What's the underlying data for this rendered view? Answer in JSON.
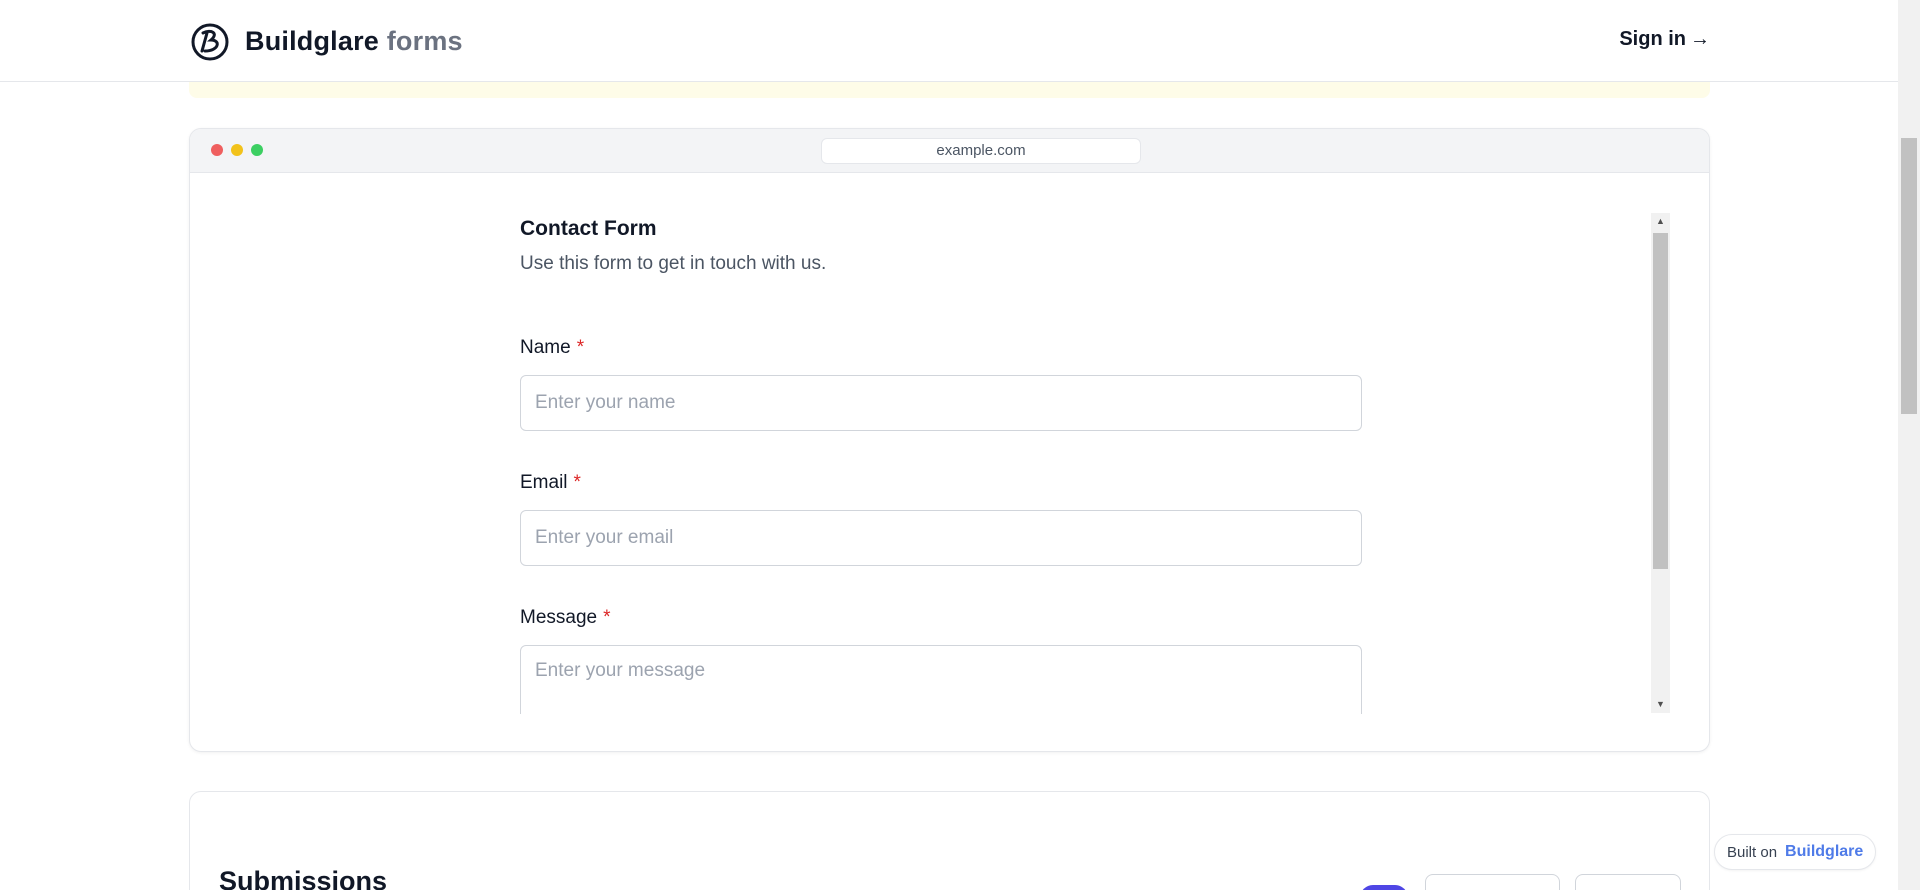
{
  "header": {
    "brand_name": "Buildglare",
    "brand_sub": "forms",
    "signin_label": "Sign in",
    "signin_arrow": "→"
  },
  "browser": {
    "url": "example.com"
  },
  "form": {
    "title": "Contact Form",
    "description": "Use this form to get in touch with us.",
    "required_mark": "*",
    "fields": [
      {
        "label": "Name",
        "placeholder": "Enter your name",
        "value": ""
      },
      {
        "label": "Email",
        "placeholder": "Enter your email",
        "value": ""
      },
      {
        "label": "Message",
        "placeholder": "Enter your message",
        "value": ""
      }
    ]
  },
  "submissions": {
    "title": "Submissions"
  },
  "badge": {
    "prefix": "Built on",
    "brand": "Buildglare"
  },
  "colors": {
    "required": "#dc2626",
    "accent": "#4f46e5",
    "badge_brand": "#4f7be8"
  }
}
